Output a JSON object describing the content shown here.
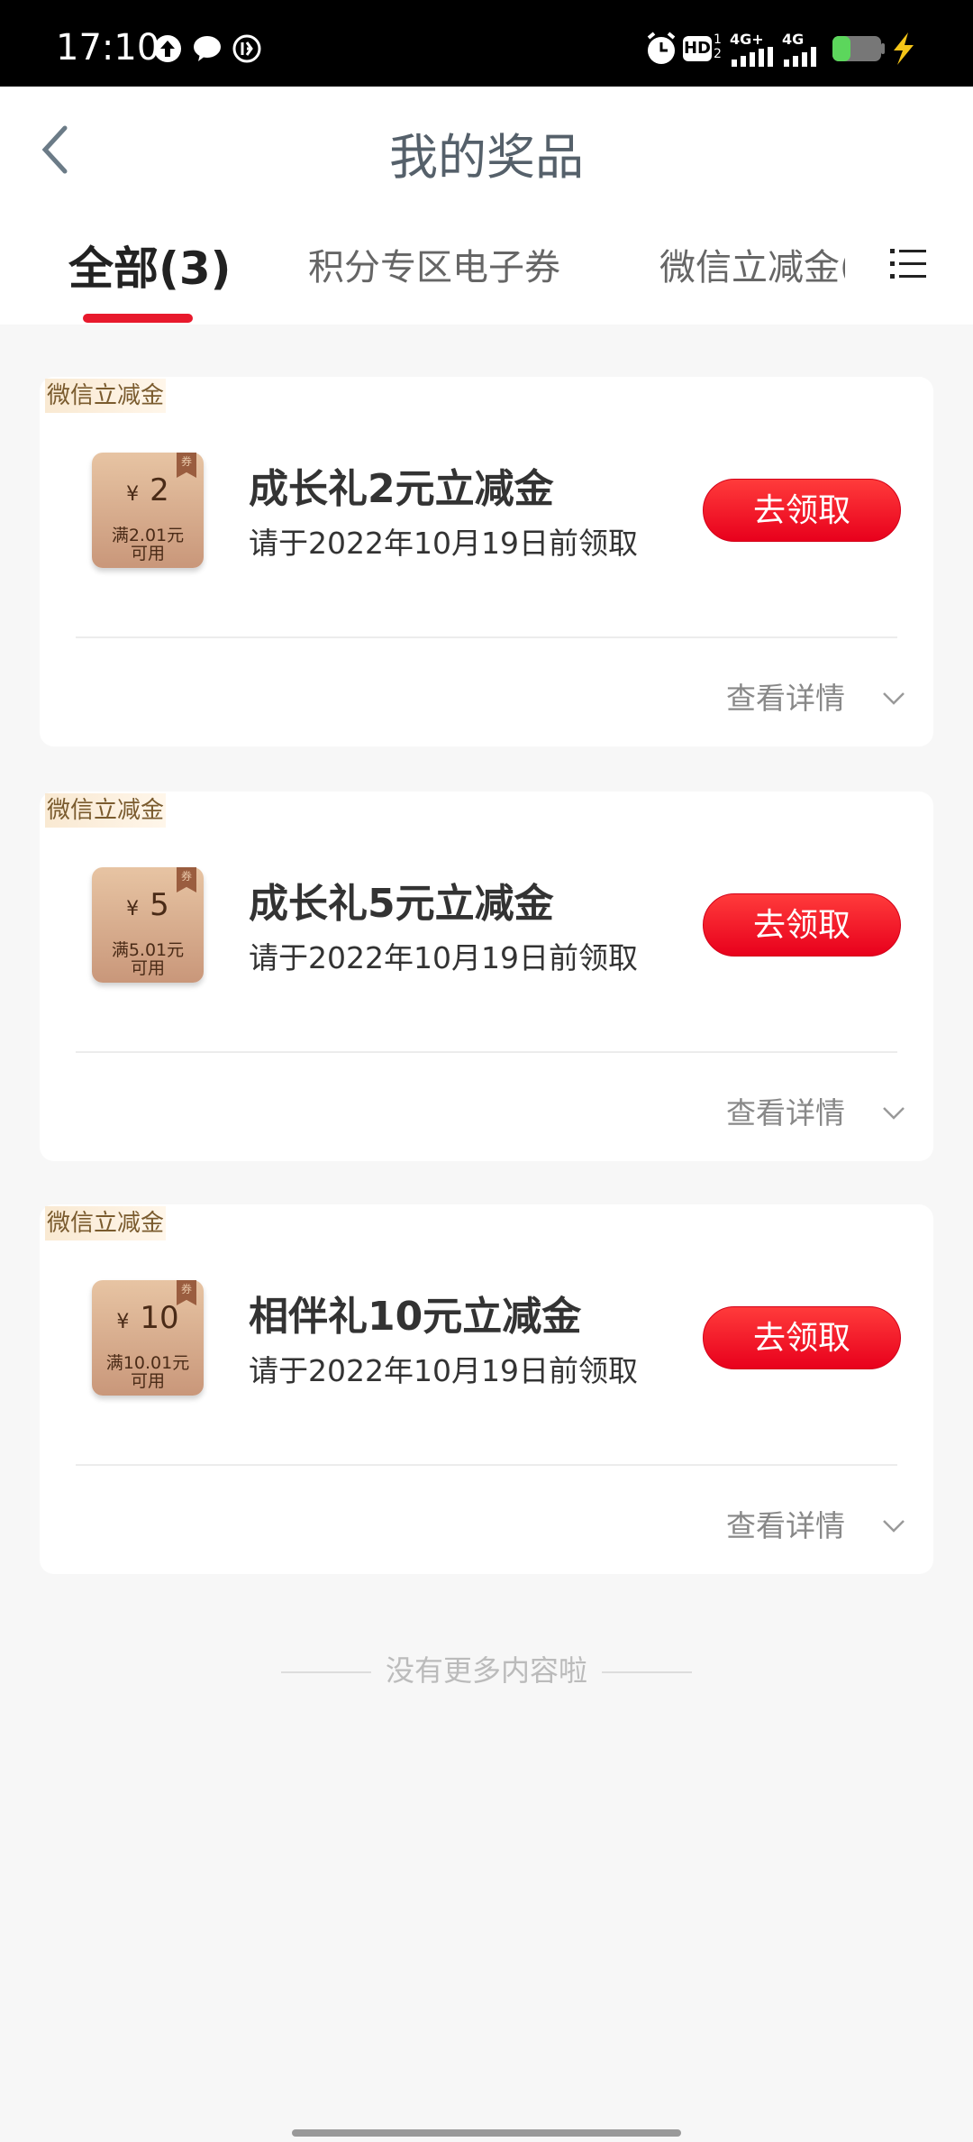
{
  "status_bar": {
    "time": "17:10",
    "right_labels": [
      "HD",
      "4G+",
      "4G"
    ]
  },
  "header": {
    "title": "我的奖品",
    "tabs": [
      {
        "label": "全部(3)",
        "active": true
      },
      {
        "label": "积分专区电子券",
        "active": false
      },
      {
        "label": "微信立减金(",
        "active": false
      }
    ]
  },
  "cards": [
    {
      "tag": "微信立减金",
      "thumb_ribbon": "券",
      "thumb_currency": "¥",
      "thumb_amount": "2",
      "thumb_condition_line1": "满2.01元",
      "thumb_condition_line2": "可用",
      "name": "成长礼2元立减金",
      "deadline": "请于2022年10月19日前领取",
      "claim_label": "去领取",
      "detail_label": "查看详情"
    },
    {
      "tag": "微信立减金",
      "thumb_ribbon": "券",
      "thumb_currency": "¥",
      "thumb_amount": "5",
      "thumb_condition_line1": "满5.01元",
      "thumb_condition_line2": "可用",
      "name": "成长礼5元立减金",
      "deadline": "请于2022年10月19日前领取",
      "claim_label": "去领取",
      "detail_label": "查看详情"
    },
    {
      "tag": "微信立减金",
      "thumb_ribbon": "券",
      "thumb_currency": "¥",
      "thumb_amount": "10",
      "thumb_condition_line1": "满10.01元",
      "thumb_condition_line2": "可用",
      "name": "相伴礼10元立减金",
      "deadline": "请于2022年10月19日前领取",
      "claim_label": "去领取",
      "detail_label": "查看详情"
    }
  ],
  "footer_note": "没有更多内容啦",
  "colors": {
    "accent_red": "#e8192c",
    "button_red": "#ff1a2e",
    "title_gray": "#55606a",
    "tag_gold": "#7a5b2e"
  }
}
